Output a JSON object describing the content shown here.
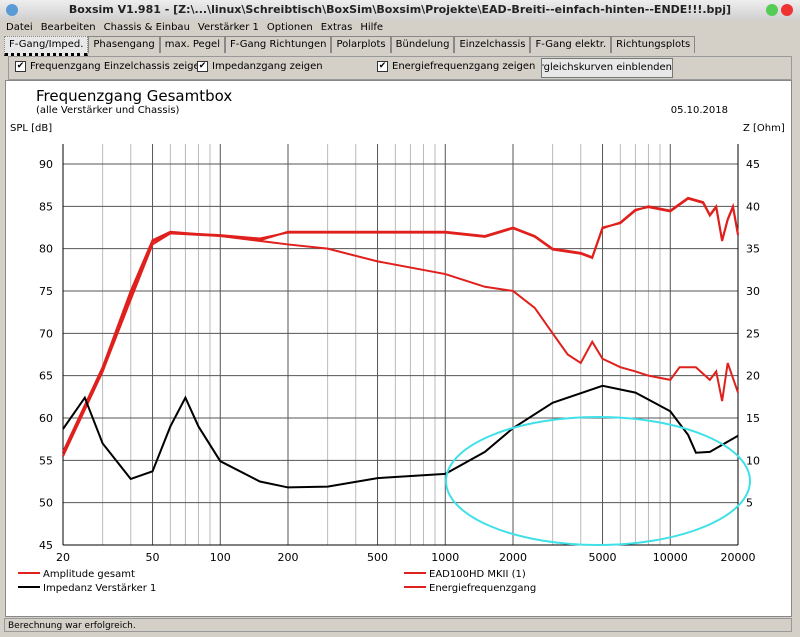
{
  "window": {
    "title": "Boxsim V1.981 - [Z:\\...\\linux\\Schreibtisch\\BoxSim\\Boxsim\\Projekte\\EAD-Breiti--einfach-hinten--ENDE!!!.bpj]"
  },
  "menu": [
    "Datei",
    "Bearbeiten",
    "Chassis & Einbau",
    "Verstärker 1",
    "Optionen",
    "Extras",
    "Hilfe"
  ],
  "tabs": [
    "F-Gang/Imped.",
    "Phasengang",
    "max. Pegel",
    "F-Gang Richtungen",
    "Polarplots",
    "Bündelung",
    "Einzelchassis",
    "F-Gang elektr.",
    "Richtungsplots"
  ],
  "options": {
    "cb1": "Frequenzgang Einzelchassis zeigen",
    "cb2": "Impedanzgang zeigen",
    "cb3": "Energiefrequenzgang zeigen",
    "button": "Vergleichskurven einblenden",
    "check": "✔"
  },
  "status": "Berechnung war erfolgreich.",
  "colors": {
    "red": "#e0201c",
    "black": "#000000",
    "annotation": "#40e0e8"
  },
  "chart_data": {
    "type": "line",
    "title": "Frequenzgang Gesamtbox",
    "subtitle": "(alle Verstärker und Chassis)",
    "date": "05.10.2018",
    "ylabel": "SPL [dB]",
    "y2label": "Z [Ohm]",
    "xscale": "log",
    "xlim": [
      20,
      20000
    ],
    "ylim": [
      45,
      90
    ],
    "y2lim": [
      0,
      45
    ],
    "xticks": [
      20,
      50,
      100,
      200,
      500,
      1000,
      2000,
      5000,
      10000,
      20000
    ],
    "yticks": [
      45,
      50,
      55,
      60,
      65,
      70,
      75,
      80,
      85,
      90
    ],
    "y2ticks": [
      5,
      10,
      15,
      20,
      25,
      30,
      35,
      40,
      45
    ],
    "series": [
      {
        "name": "Amplitude gesamt",
        "axis": "left",
        "color": "#e0201c",
        "x": [
          20,
          30,
          40,
          50,
          60,
          100,
          150,
          200,
          500,
          1000,
          1500,
          2000,
          2500,
          3000,
          4000,
          4500,
          5000,
          6000,
          7000,
          8000,
          10000,
          12000,
          14000,
          15000,
          16000,
          17000,
          18000,
          19000,
          20000
        ],
        "y": [
          56,
          66,
          75,
          81,
          82,
          81.5,
          81,
          82,
          82,
          82,
          81.5,
          82.5,
          81.5,
          80,
          79.5,
          79,
          82.5,
          83,
          84.5,
          85,
          84.5,
          86,
          85.5,
          84,
          85,
          81,
          83.5,
          85,
          81.7
        ]
      },
      {
        "name": "EAD100HD MKII (1)",
        "axis": "left",
        "color": "#e0201c",
        "x": [
          20,
          30,
          40,
          50,
          60,
          100,
          150,
          200,
          500,
          1000,
          1500,
          2000,
          2500,
          3000,
          4000,
          4500,
          5000,
          6000,
          7000,
          8000,
          10000,
          12000,
          14000,
          15000,
          16000,
          17000,
          18000,
          19000,
          20000
        ],
        "y": [
          55.5,
          65.5,
          74.5,
          80.8,
          81.9,
          81.6,
          81.2,
          81.9,
          81.9,
          81.9,
          81.4,
          82.4,
          81.4,
          79.9,
          79.4,
          78.9,
          82.4,
          83.1,
          84.6,
          84.9,
          84.4,
          85.9,
          85.4,
          83.9,
          84.9,
          80.9,
          83.4,
          84.9,
          81.6
        ]
      },
      {
        "name": "Energiefrequenzgang",
        "axis": "left",
        "color": "#e0201c",
        "x": [
          20,
          30,
          40,
          50,
          60,
          100,
          200,
          300,
          500,
          1000,
          1500,
          2000,
          2500,
          3000,
          3500,
          4000,
          4500,
          5000,
          6000,
          7000,
          8000,
          10000,
          11000,
          13000,
          15000,
          16000,
          17000,
          18000,
          20000
        ],
        "y": [
          55.5,
          65.5,
          74,
          80.5,
          81.8,
          81.5,
          80.5,
          80,
          78.5,
          77,
          75.5,
          75,
          73,
          70,
          67.5,
          66.5,
          69,
          67,
          66,
          65.5,
          65,
          64.5,
          66,
          66,
          64.5,
          65.5,
          62,
          66.5,
          63
        ]
      },
      {
        "name": "Impedanz Verstärker 1",
        "axis": "right",
        "color": "#000000",
        "x": [
          20,
          25,
          30,
          40,
          50,
          60,
          70,
          80,
          100,
          150,
          200,
          300,
          500,
          1000,
          1500,
          2000,
          3000,
          5000,
          7000,
          10000,
          12000,
          13000,
          15000,
          20000
        ],
        "y": [
          13.7,
          17.4,
          12,
          7.8,
          8.7,
          14,
          17.4,
          14,
          9.9,
          7.5,
          6.8,
          6.9,
          7.9,
          8.4,
          11,
          13.8,
          16.8,
          18.8,
          18,
          15.8,
          13,
          10.9,
          11,
          12.9
        ]
      }
    ]
  }
}
